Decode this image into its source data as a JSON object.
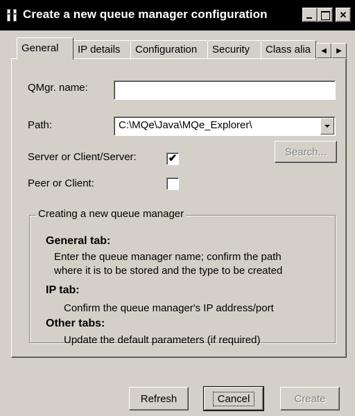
{
  "window": {
    "title": "Create a new queue manager configuration",
    "icon": "app-icon"
  },
  "tabs": [
    {
      "label": "General",
      "active": true
    },
    {
      "label": "IP details",
      "active": false
    },
    {
      "label": "Configuration",
      "active": false
    },
    {
      "label": "Security",
      "active": false
    },
    {
      "label": "Class alia",
      "active": false
    }
  ],
  "form": {
    "qmgr_label": "QMgr. name:",
    "qmgr_value": "",
    "path_label": "Path:",
    "path_value": "C:\\MQe\\Java\\MQe_Explorer\\",
    "search_label": "Search...",
    "server_label": "Server or Client/Server:",
    "server_checked": true,
    "server_mark": "✔",
    "peer_label": "Peer or Client:",
    "peer_checked": false,
    "peer_mark": ""
  },
  "help": {
    "legend": "Creating a new queue manager",
    "general_head": "General tab:",
    "general_line1": "Enter the queue manager name; confirm the path",
    "general_line2": "where it is to be stored and the type to be created",
    "ip_head": "IP tab:",
    "ip_line1": "Confirm the queue manager's IP address/port",
    "other_head": "Other tabs:",
    "other_line1": "Update the default parameters (if required)"
  },
  "buttons": {
    "refresh": "Refresh",
    "cancel": "Cancel",
    "create": "Create"
  }
}
